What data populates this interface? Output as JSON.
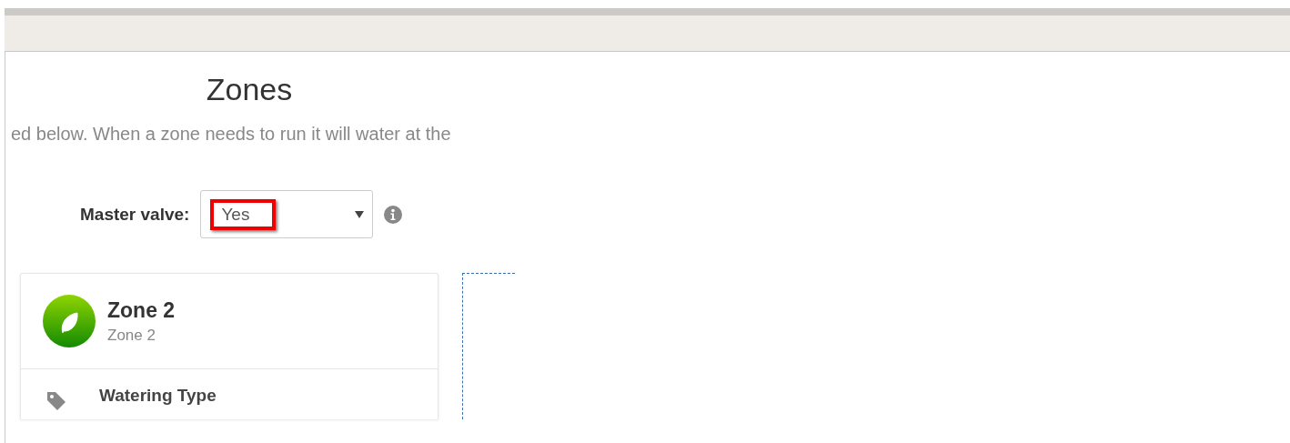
{
  "page": {
    "title": "Zones",
    "description": "ed below. When a zone needs to run it will water at the"
  },
  "master_valve": {
    "label": "Master valve:",
    "value": "Yes",
    "highlighted": true
  },
  "zones": [
    {
      "name": "Zone 2",
      "subtitle": "Zone 2",
      "fields": [
        {
          "label": "Watering Type"
        }
      ]
    }
  ]
}
